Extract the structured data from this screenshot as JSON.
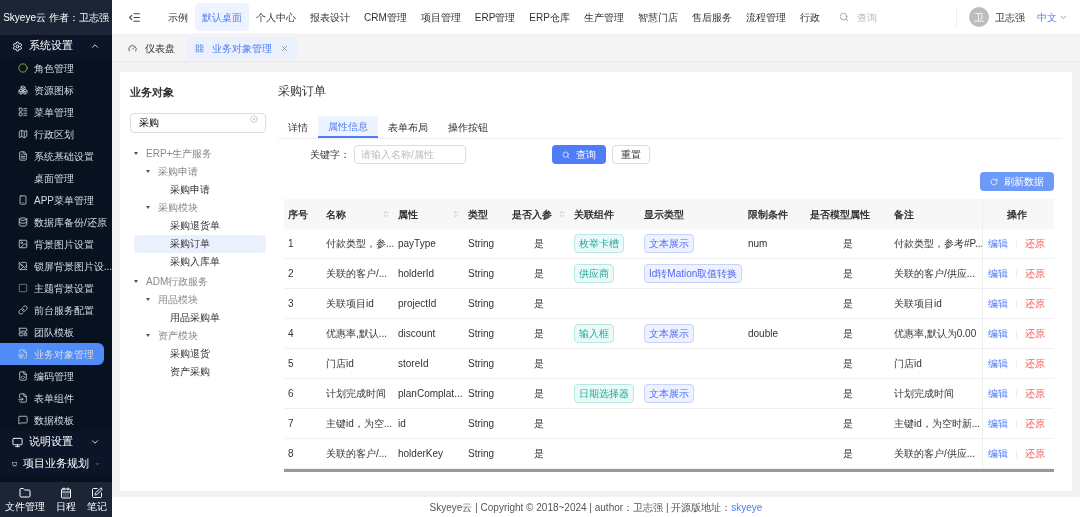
{
  "sidebar": {
    "brand": "Skyeye云 作者：卫志强",
    "sections": [
      {
        "label": "系统设置",
        "expanded": true,
        "items": [
          {
            "label": "角色管理",
            "selected": false
          },
          {
            "label": "资源图标",
            "selected": false
          },
          {
            "label": "菜单管理",
            "selected": false
          },
          {
            "label": "行政区划",
            "selected": false
          },
          {
            "label": "系统基础设置",
            "selected": false
          },
          {
            "label": "桌面管理",
            "selected": false
          },
          {
            "label": "APP菜单管理",
            "selected": false
          },
          {
            "label": "数据库备份/还原",
            "selected": false
          },
          {
            "label": "背景图片设置",
            "selected": false
          },
          {
            "label": "锁屏背景图片设...",
            "selected": false
          },
          {
            "label": "主题背景设置",
            "selected": false
          },
          {
            "label": "前台服务配置",
            "selected": false
          },
          {
            "label": "团队模板",
            "selected": false
          },
          {
            "label": "业务对象管理",
            "selected": true
          },
          {
            "label": "编码管理",
            "selected": false
          },
          {
            "label": "表单组件",
            "selected": false
          },
          {
            "label": "数据模板",
            "selected": false
          }
        ]
      },
      {
        "label": "说明设置",
        "expanded": false
      },
      {
        "label": "项目业务规划",
        "expanded": false
      }
    ],
    "bottom": [
      "文件管理",
      "日程",
      "笔记"
    ]
  },
  "top_nav": {
    "items": [
      {
        "label": "示例",
        "selected": false
      },
      {
        "label": "默认桌面",
        "selected": true
      },
      {
        "label": "个人中心",
        "selected": false
      },
      {
        "label": "报表设计",
        "selected": false
      },
      {
        "label": "CRM管理",
        "selected": false
      },
      {
        "label": "项目管理",
        "selected": false
      },
      {
        "label": "ERP管理",
        "selected": false
      },
      {
        "label": "ERP仓库",
        "selected": false
      },
      {
        "label": "生产管理",
        "selected": false
      },
      {
        "label": "智慧门店",
        "selected": false
      },
      {
        "label": "售后服务",
        "selected": false
      },
      {
        "label": "流程管理",
        "selected": false
      },
      {
        "label": "行政",
        "selected": false
      }
    ],
    "search_placeholder": "查询",
    "avatar": "卫",
    "user": "卫志强",
    "language": "中文"
  },
  "page_tabs": [
    {
      "label": "仪表盘",
      "selected": false,
      "closable": false
    },
    {
      "label": "业务对象管理",
      "selected": true,
      "closable": true
    }
  ],
  "object_tree": {
    "title": "业务对象",
    "search": "采购",
    "nodes": [
      {
        "label": "ERP+生产服务",
        "selected": false,
        "children": [
          {
            "label": "采购申请",
            "selected": false,
            "children": [
              {
                "label": "采购申请",
                "selected": false
              }
            ]
          },
          {
            "label": "采购模块",
            "selected": false,
            "children": [
              {
                "label": "采购退货单",
                "selected": false
              },
              {
                "label": "采购订单",
                "selected": true
              },
              {
                "label": "采购入库单",
                "selected": false
              }
            ]
          }
        ]
      },
      {
        "label": "ADM行政服务",
        "selected": false,
        "children": [
          {
            "label": "用品模块",
            "selected": false,
            "children": [
              {
                "label": "用品采购单",
                "selected": false
              }
            ]
          },
          {
            "label": "资产模块",
            "selected": false,
            "children": [
              {
                "label": "采购退货",
                "selected": false
              },
              {
                "label": "资产采购",
                "selected": false
              }
            ]
          }
        ]
      }
    ]
  },
  "detail": {
    "title": "采购订单",
    "tabs": [
      {
        "label": "详情",
        "selected": false
      },
      {
        "label": "属性信息",
        "selected": true
      },
      {
        "label": "表单布局",
        "selected": false
      },
      {
        "label": "操作按钮",
        "selected": false
      }
    ],
    "keyword_label": "关键字：",
    "keyword_placeholder": "请输入名称/属性",
    "query_button": "查询",
    "reset_button": "重置",
    "refresh_button": "刷新数据",
    "table": {
      "columns": [
        {
          "label": "序号",
          "sortable": false
        },
        {
          "label": "名称",
          "sortable": true
        },
        {
          "label": "属性",
          "sortable": true
        },
        {
          "label": "类型",
          "sortable": false
        },
        {
          "label": "是否入参",
          "sortable": true
        },
        {
          "label": "关联组件",
          "sortable": false
        },
        {
          "label": "显示类型",
          "sortable": false
        },
        {
          "label": "限制条件",
          "sortable": false
        },
        {
          "label": "是否模型属性",
          "sortable": false
        },
        {
          "label": "备注",
          "sortable": false
        },
        {
          "label": "操作",
          "sortable": false
        }
      ],
      "rows": [
        {
          "no": "1",
          "name": "付款类型，参...",
          "attr": "payType",
          "type": "String",
          "param": "是",
          "component": "枚举卡槽",
          "display": "文本展示",
          "limit": "num",
          "model": "是",
          "remark": "付款类型，参考#P...",
          "edit": "编辑",
          "restore": "还原"
        },
        {
          "no": "2",
          "name": "关联的客户/...",
          "attr": "holderId",
          "type": "String",
          "param": "是",
          "component": "供应商",
          "display": "Id转Mation取值转换",
          "model": "是",
          "remark": "关联的客户/供应...",
          "edit": "编辑",
          "restore": "还原"
        },
        {
          "no": "3",
          "name": "关联项目id",
          "attr": "projectId",
          "type": "String",
          "param": "是",
          "model": "是",
          "remark": "关联项目id",
          "edit": "编辑",
          "restore": "还原"
        },
        {
          "no": "4",
          "name": "优惠率,默认...",
          "attr": "discount",
          "type": "String",
          "param": "是",
          "component": "输入框",
          "display": "文本展示",
          "limit": "double",
          "model": "是",
          "remark": "优惠率,默认为0.00",
          "edit": "编辑",
          "restore": "还原"
        },
        {
          "no": "5",
          "name": "门店id",
          "attr": "storeId",
          "type": "String",
          "param": "是",
          "model": "是",
          "remark": "门店id",
          "edit": "编辑",
          "restore": "还原"
        },
        {
          "no": "6",
          "name": "计划完成时间",
          "attr": "planComplat...",
          "type": "String",
          "param": "是",
          "component": "日期选择器",
          "display": "文本展示",
          "model": "是",
          "remark": "计划完成时间",
          "edit": "编辑",
          "restore": "还原"
        },
        {
          "no": "7",
          "name": "主键id，为空...",
          "attr": "id",
          "type": "String",
          "param": "是",
          "model": "是",
          "remark": "主键id，为空时新...",
          "edit": "编辑",
          "restore": "还原"
        },
        {
          "no": "8",
          "name": "关联的客户/...",
          "attr": "holderKey",
          "type": "String",
          "param": "是",
          "model": "是",
          "remark": "关联的客户/供应...",
          "edit": "编辑",
          "restore": "还原"
        }
      ]
    }
  },
  "footer": {
    "text": "Skyeye云 | Copyright © 2018~2024 | author：卫志强 | 开源版地址：",
    "link": "skyeye"
  }
}
